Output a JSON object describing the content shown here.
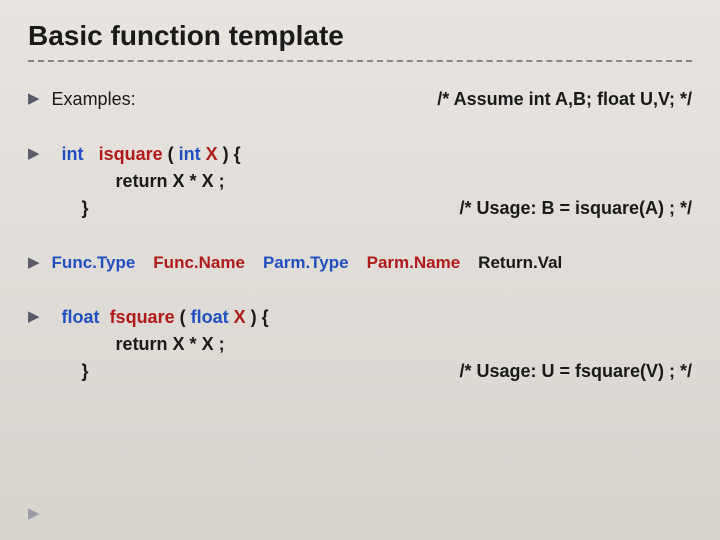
{
  "title": "Basic function template",
  "row1": {
    "label": "Examples:",
    "comment": "/* Assume int A,B; float U,V; */"
  },
  "isquare": {
    "type": "int",
    "name": "isquare",
    "parmtype": "int",
    "parmname": "X",
    "open": "( ",
    "close": " ) {",
    "ret": "return X * X ;",
    "brace": "}",
    "usage": "/* Usage:  B = isquare(A) ;  */"
  },
  "legend": {
    "functype": "Func.Type",
    "funcname": "Func.Name",
    "parmtype": "Parm.Type",
    "parmname": "Parm.Name",
    "returnval": "Return.Val"
  },
  "fsquare": {
    "type": "float",
    "name": "fsquare",
    "parmtype": "float",
    "parmname": "X",
    "open": "( ",
    "close": " ) {",
    "ret": "return X * X ;",
    "brace": "}",
    "usage": "/* Usage:  U = fsquare(V) ;  */"
  }
}
